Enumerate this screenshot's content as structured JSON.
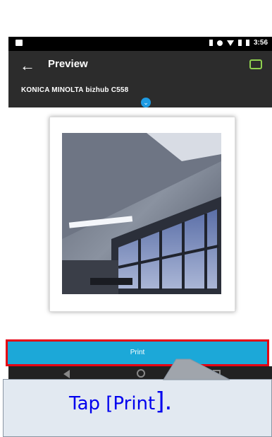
{
  "status_bar": {
    "time": "3:56",
    "battery_icon": "battery-icon",
    "wifi_icon": "wifi-icon",
    "signal_icon": "signal-icon"
  },
  "app_bar": {
    "back_icon": "arrow-left-icon",
    "title": "Preview",
    "action_icon": "printer-settings-icon"
  },
  "printer": {
    "name": "KONICA MINOLTA bizhub C558",
    "expand_icon": "chevron-down-icon"
  },
  "preview": {
    "image": "office-ceiling-photo"
  },
  "print_button": {
    "label": "Print",
    "highlight_color": "#e60012",
    "color": "#1ca8d8"
  },
  "nav_bar": {
    "back_icon": "nav-back-icon",
    "home_icon": "nav-home-icon",
    "recent_icon": "nav-recent-icon"
  },
  "callout": {
    "text_prefix": "Tap [Print",
    "text_suffix": "]",
    "text_end": "."
  }
}
